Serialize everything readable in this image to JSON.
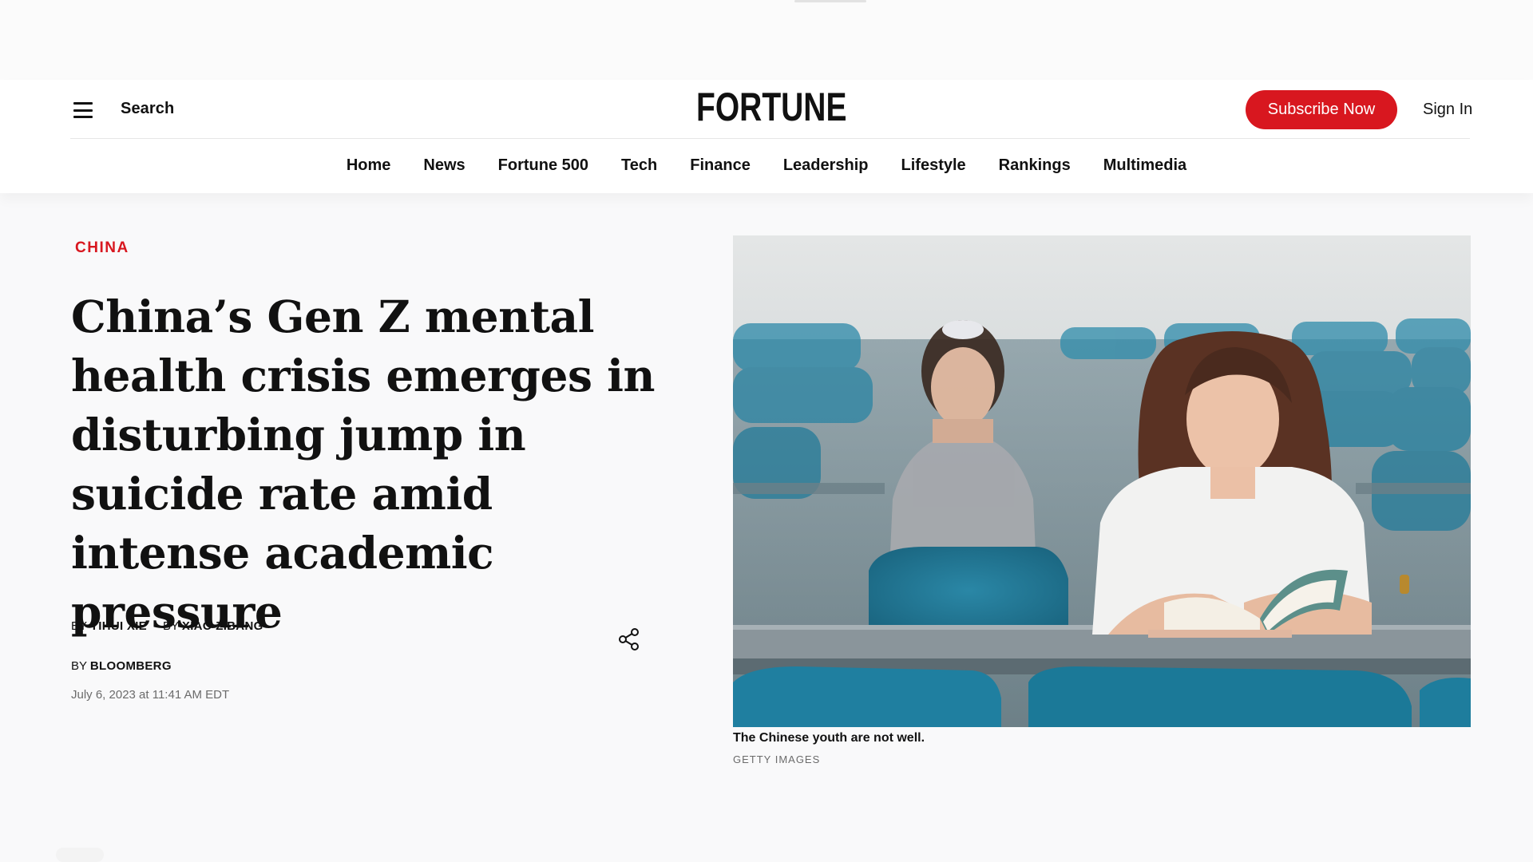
{
  "header": {
    "search_label": "Search",
    "logo_text": "FORTUNE",
    "subscribe_label": "Subscribe Now",
    "signin_label": "Sign In"
  },
  "nav": {
    "items": [
      {
        "label": "Home"
      },
      {
        "label": "News"
      },
      {
        "label": "Fortune 500"
      },
      {
        "label": "Tech"
      },
      {
        "label": "Finance"
      },
      {
        "label": "Leadership"
      },
      {
        "label": "Lifestyle"
      },
      {
        "label": "Rankings"
      },
      {
        "label": "Multimedia"
      }
    ]
  },
  "article": {
    "category": "CHINA",
    "headline": "China’s Gen Z mental health crisis emerges in disturbing jump in suicide rate amid intense academic pressure",
    "bylines": [
      {
        "prefix": "By",
        "name": "Yihui Xie"
      },
      {
        "prefix": "By",
        "name": "Xiao Zibang"
      },
      {
        "prefix": "By",
        "name": "Bloomberg"
      }
    ],
    "date": "July 6, 2023 at 11:41 AM EDT",
    "image_caption": "The Chinese youth are not well.",
    "image_credit": "Getty Images"
  },
  "colors": {
    "accent": "#d8171f",
    "text": "#111111",
    "muted": "#6b6b6b",
    "seat_teal": "#1f7fa0"
  },
  "icons": {
    "menu": "hamburger-icon",
    "share": "share-icon"
  }
}
